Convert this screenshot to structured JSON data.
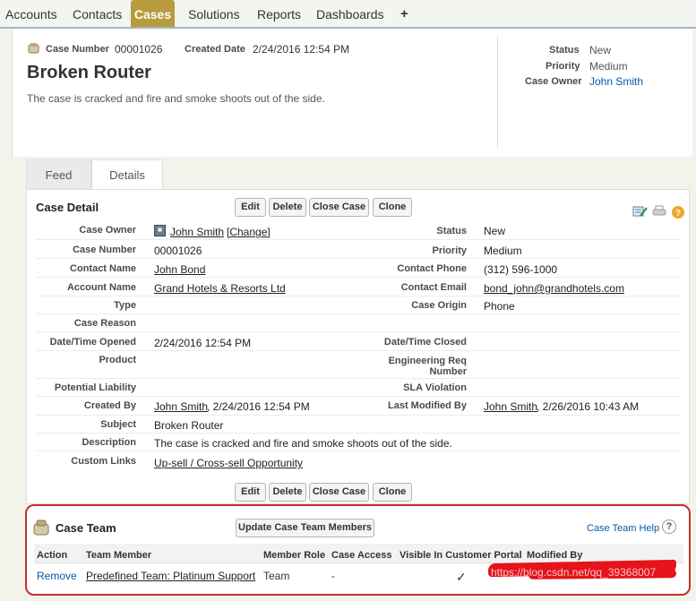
{
  "nav": {
    "tabs": [
      "Accounts",
      "Contacts",
      "Cases",
      "Solutions",
      "Reports",
      "Dashboards"
    ],
    "active": "Cases",
    "add_icon": "+"
  },
  "header": {
    "case_number_label": "Case Number",
    "case_number": "00001026",
    "created_date_label": "Created Date",
    "created_date": "2/24/2016 12:54 PM",
    "title": "Broken Router",
    "description": "The case is cracked and fire and smoke shoots out of the side.",
    "status_label": "Status",
    "status": "New",
    "priority_label": "Priority",
    "priority": "Medium",
    "owner_label": "Case Owner",
    "owner": "John Smith"
  },
  "tabs": {
    "feed": "Feed",
    "details": "Details"
  },
  "detail": {
    "title": "Case Detail",
    "buttons": {
      "edit": "Edit",
      "delete": "Delete",
      "close": "Close Case",
      "clone": "Clone"
    },
    "fields": {
      "case_owner": {
        "label": "Case Owner",
        "value": "John Smith",
        "change": "[Change]"
      },
      "status": {
        "label": "Status",
        "value": "New"
      },
      "case_number": {
        "label": "Case Number",
        "value": "00001026"
      },
      "priority": {
        "label": "Priority",
        "value": "Medium"
      },
      "contact_name": {
        "label": "Contact Name",
        "value": "John Bond"
      },
      "contact_phone": {
        "label": "Contact Phone",
        "value": "(312) 596-1000"
      },
      "account_name": {
        "label": "Account Name",
        "value": "Grand Hotels & Resorts Ltd"
      },
      "contact_email": {
        "label": "Contact Email",
        "value": "bond_john@grandhotels.com"
      },
      "type": {
        "label": "Type",
        "value": ""
      },
      "case_origin": {
        "label": "Case Origin",
        "value": "Phone"
      },
      "case_reason": {
        "label": "Case Reason",
        "value": ""
      },
      "opened": {
        "label": "Date/Time Opened",
        "value": "2/24/2016 12:54 PM"
      },
      "closed": {
        "label": "Date/Time Closed",
        "value": ""
      },
      "product": {
        "label": "Product",
        "value": ""
      },
      "eng_req_1": "Engineering Req",
      "eng_req_2": "Number",
      "potential_liability": {
        "label": "Potential Liability",
        "value": ""
      },
      "sla_violation": {
        "label": "SLA Violation",
        "value": ""
      },
      "created_by": {
        "label": "Created By",
        "link": "John Smith",
        "date": ", 2/24/2016 12:54 PM"
      },
      "last_modified_by": {
        "label": "Last Modified By",
        "link": "John Smith",
        "date": ", 2/26/2016 10:43 AM"
      },
      "subject": {
        "label": "Subject",
        "value": "Broken Router"
      },
      "description": {
        "label": "Description",
        "value": "The case is cracked and fire and smoke shoots out of the side."
      },
      "custom_links": {
        "label": "Custom Links",
        "value": "Up-sell / Cross-sell Opportunity"
      }
    }
  },
  "team": {
    "title": "Case Team",
    "update_button": "Update Case Team Members",
    "help": "Case Team Help",
    "help_icon": "?",
    "columns": [
      "Action",
      "Team Member",
      "Member Role",
      "Case Access",
      "Visible In Customer Portal",
      "Modified By"
    ],
    "row": {
      "action": "Remove",
      "member": "Predefined Team: Platinum Support",
      "role": "Team",
      "access": "-",
      "visible": "✓"
    },
    "watermark": "https://blog.csdn.net/qq_39368007"
  }
}
